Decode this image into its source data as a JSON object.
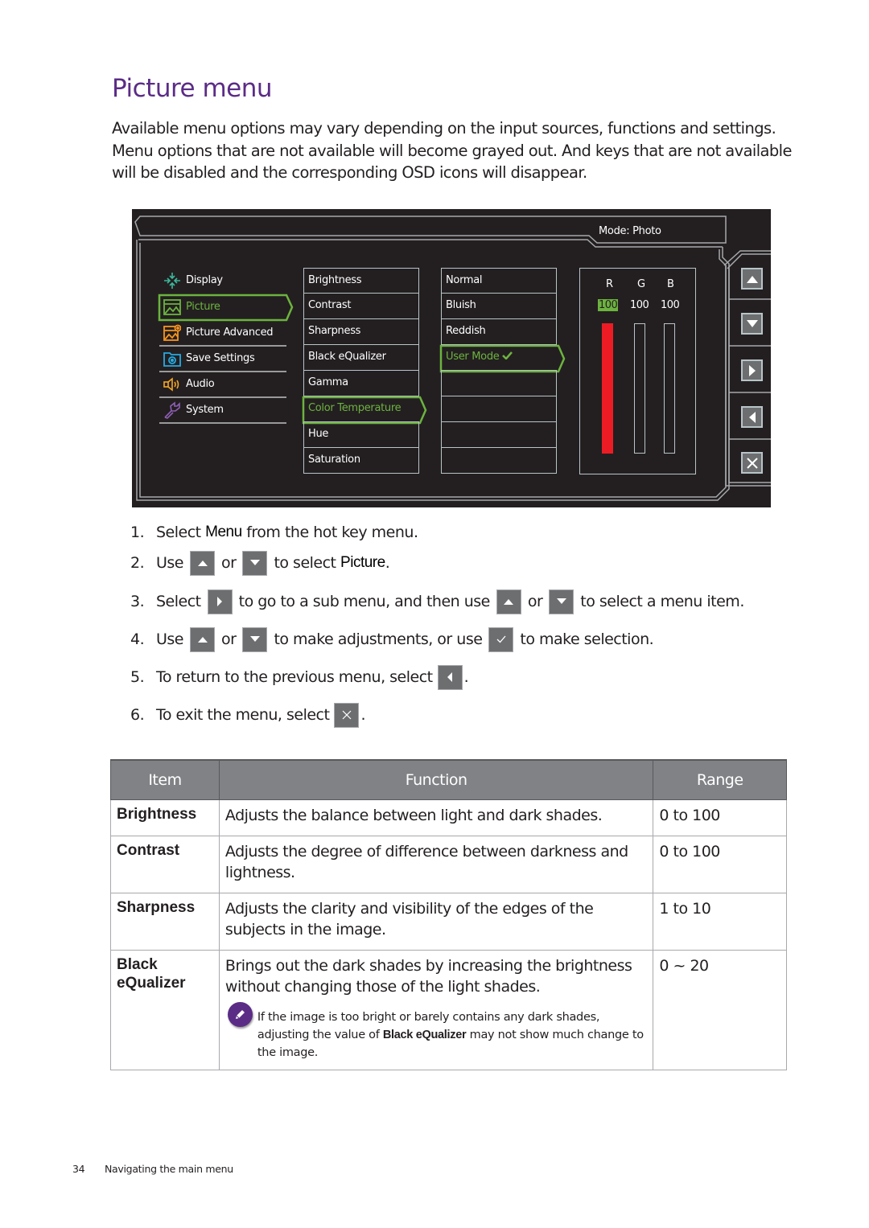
{
  "page": {
    "title": "Picture menu",
    "intro": "Available menu options may vary depending on the input sources, functions and settings. Menu options that are not available will become grayed out. And keys that are not available will be disabled and the corresponding OSD icons will disappear."
  },
  "osd": {
    "mode_label": "Mode: Photo",
    "main_menu": [
      {
        "label": "Display",
        "icon": "display-icon",
        "active": false
      },
      {
        "label": "Picture",
        "icon": "picture-icon",
        "active": true
      },
      {
        "label": "Picture Advanced",
        "icon": "picture-advanced-icon",
        "active": false
      },
      {
        "label": "Save Settings",
        "icon": "save-settings-icon",
        "active": false
      },
      {
        "label": "Audio",
        "icon": "audio-icon",
        "active": false
      },
      {
        "label": "System",
        "icon": "system-icon",
        "active": false
      }
    ],
    "sub_menu": [
      {
        "label": "Brightness"
      },
      {
        "label": "Contrast"
      },
      {
        "label": "Sharpness"
      },
      {
        "label": "Black eQualizer"
      },
      {
        "label": "Gamma"
      },
      {
        "label": "Color Temperature",
        "active": true
      },
      {
        "label": "Hue"
      },
      {
        "label": "Saturation"
      }
    ],
    "options": [
      {
        "label": "Normal"
      },
      {
        "label": "Bluish"
      },
      {
        "label": "Reddish"
      },
      {
        "label": "User Mode",
        "active": true,
        "checked": true
      },
      {
        "label": ""
      },
      {
        "label": ""
      },
      {
        "label": ""
      },
      {
        "label": ""
      }
    ],
    "rgb": {
      "channels": [
        {
          "name": "R",
          "value": "100",
          "active": true,
          "level_percent": 100
        },
        {
          "name": "G",
          "value": "100",
          "active": false,
          "level_percent": 0
        },
        {
          "name": "B",
          "value": "100",
          "active": false,
          "level_percent": 0
        }
      ],
      "active_color": "#ed1c24"
    },
    "buttons": [
      "up-arrow-icon",
      "down-arrow-icon",
      "right-arrow-icon",
      "left-arrow-icon",
      "close-icon"
    ],
    "accent_color": "#6cb33f"
  },
  "steps": [
    {
      "num": "1.",
      "parts": [
        "Select ",
        "Menu",
        " from the hot key menu."
      ]
    },
    {
      "num": "2.",
      "parts": [
        "Use",
        "or",
        "to select ",
        "Picture",
        "."
      ]
    },
    {
      "num": "3.",
      "parts": [
        "Select",
        "to go to a sub menu, and then use",
        "or",
        "to select a menu item."
      ]
    },
    {
      "num": "4.",
      "parts": [
        "Use",
        "or",
        "to make adjustments, or use",
        "to make selection."
      ]
    },
    {
      "num": "5.",
      "parts": [
        "To return to the previous menu, select",
        "."
      ]
    },
    {
      "num": "6.",
      "parts": [
        "To exit the menu, select",
        "."
      ]
    }
  ],
  "table": {
    "headers": [
      "Item",
      "Function",
      "Range"
    ],
    "rows": [
      {
        "item": "Brightness",
        "function": "Adjusts the balance between light and dark shades.",
        "range": "0 to 100"
      },
      {
        "item": "Contrast",
        "function": "Adjusts the degree of difference between darkness and lightness.",
        "range": "0 to 100"
      },
      {
        "item": "Sharpness",
        "function": "Adjusts the clarity and visibility of the edges of the subjects in the image.",
        "range": "1 to 10"
      },
      {
        "item": "Black eQualizer",
        "function": "Brings out the dark shades by increasing the brightness without changing those of the light shades.",
        "range": "0 ~ 20",
        "note": {
          "before": "If the image is too bright or barely contains any dark shades, adjusting the value of ",
          "bold": "Black eQualizer",
          "after": " may not show much change to the image."
        }
      }
    ]
  },
  "footer": {
    "page_number": "34",
    "section": "Navigating the main menu"
  },
  "colors": {
    "title": "#5b2c86",
    "table_header": "#808285",
    "key_bg": "#6d6e70"
  }
}
